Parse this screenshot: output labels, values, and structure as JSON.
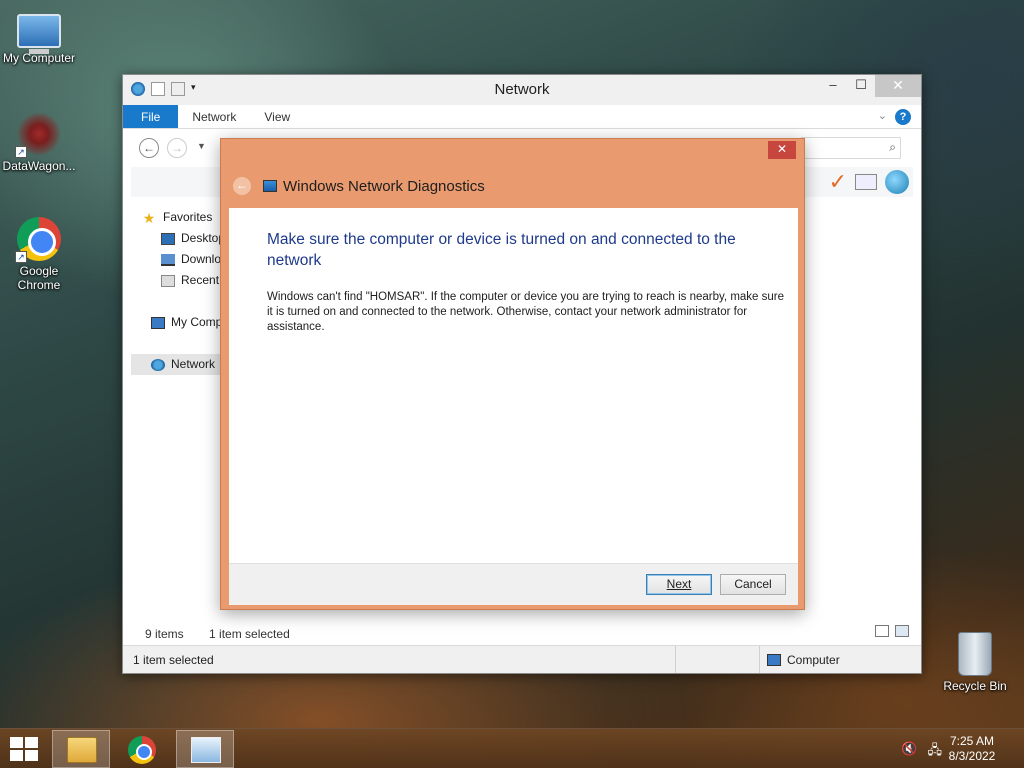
{
  "desktop": {
    "icons": [
      {
        "label": "My Computer"
      },
      {
        "label": "DataWagon..."
      },
      {
        "label": "Google Chrome"
      },
      {
        "label": "Recycle Bin"
      }
    ]
  },
  "explorer": {
    "title": "Network",
    "window_controls": {
      "minimize": "–",
      "maximize": "☐",
      "close": "✕"
    },
    "ribbon_tabs": [
      "File",
      "Network",
      "View"
    ],
    "nav_pane": [
      {
        "label": "Favorites",
        "icon": "star-icon"
      },
      {
        "label": "Desktop",
        "icon": "desktop-icon"
      },
      {
        "label": "Downloads",
        "icon": "downloads-icon"
      },
      {
        "label": "Recent places",
        "icon": "recent-icon"
      },
      {
        "label": "My Computer",
        "icon": "computer-icon"
      },
      {
        "label": "Network",
        "icon": "network-icon"
      }
    ],
    "items_count": "9 items",
    "items_selected": "1 item selected",
    "statusbar": {
      "left": "1 item selected",
      "right": "Computer"
    }
  },
  "dialog": {
    "title": "Windows Network Diagnostics",
    "close": "✕",
    "heading": "Make sure the computer or device is turned on and connected to the network",
    "body": "Windows can't find \"HOMSAR\". If the computer or device you are trying to reach is nearby, make sure it is turned on and connected to the network. Otherwise, contact your network administrator for assistance.",
    "next_label": "Next",
    "cancel_label": "Cancel"
  },
  "taskbar": {
    "time": "7:25 AM",
    "date": "8/3/2022"
  },
  "colors": {
    "dialog_frame": "#e99a6f",
    "heading_blue": "#1e3a8a",
    "file_tab": "#1979ca",
    "dialog_close": "#c7463e"
  }
}
